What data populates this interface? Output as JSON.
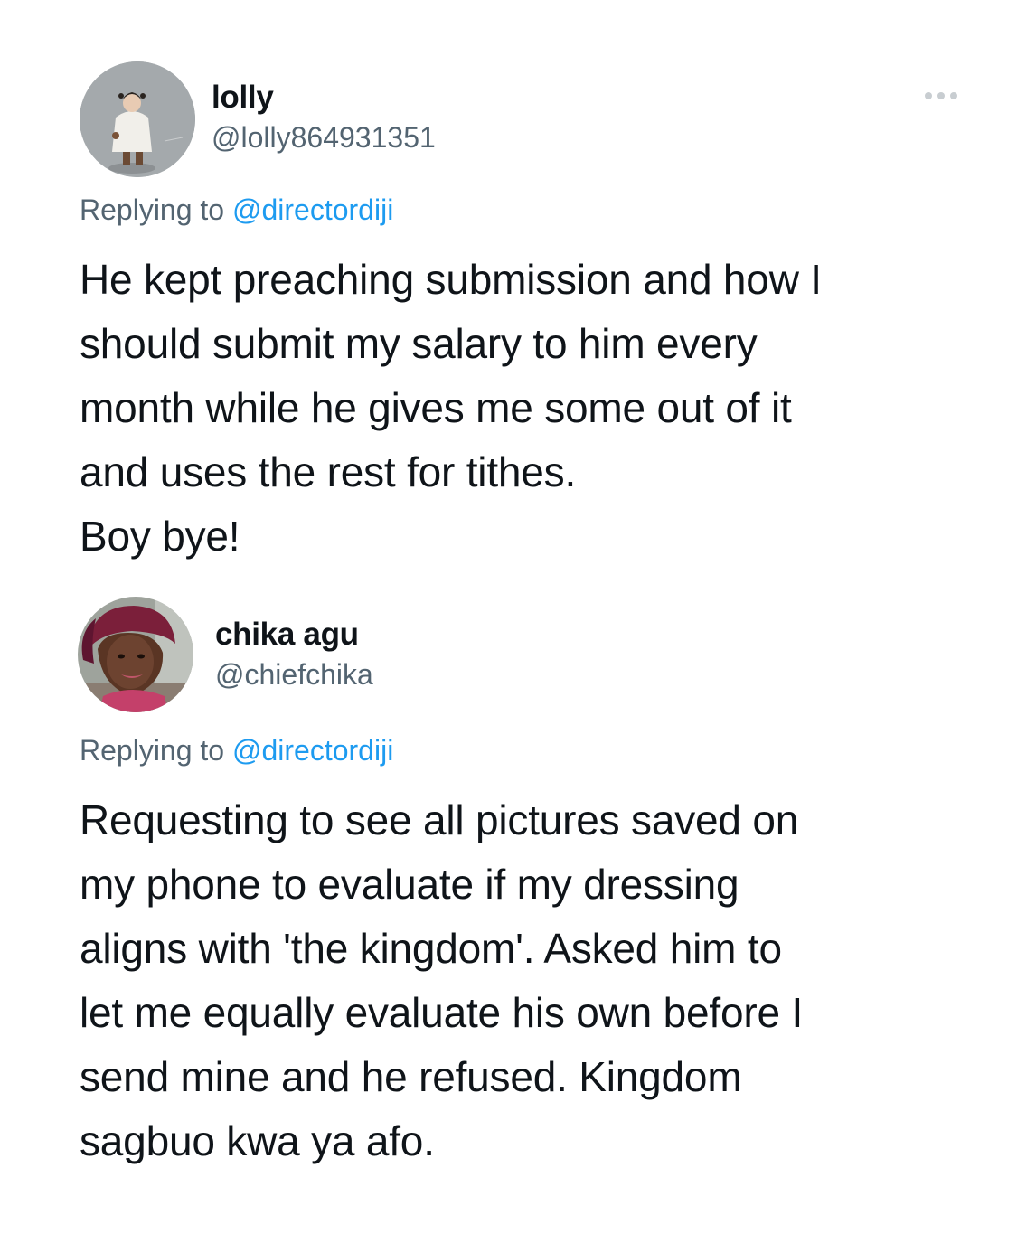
{
  "tweets": [
    {
      "display_name": "lolly",
      "handle": "@lolly864931351",
      "replying_prefix": "Replying to",
      "replying_to": "@directordiji",
      "more_icon": "more-horizontal-icon",
      "text_lines": [
        "He kept preaching submission and how I",
        "should submit my salary to him every",
        "month while he gives me some out of it",
        "and uses the rest for tithes.",
        "Boy bye!"
      ]
    },
    {
      "display_name": "chika agu",
      "handle": "@chiefchika",
      "replying_prefix": "Replying to",
      "replying_to": "@directordiji",
      "text_lines": [
        "Requesting to see all pictures saved on",
        "my phone to evaluate if my dressing",
        "aligns with 'the kingdom'. Asked him to",
        "let me equally evaluate his own before I",
        "send mine and he refused. Kingdom",
        "sagbuo kwa ya afo."
      ]
    }
  ],
  "colors": {
    "text_primary": "#0f1419",
    "text_secondary": "#536471",
    "mention": "#1d9bf0"
  }
}
